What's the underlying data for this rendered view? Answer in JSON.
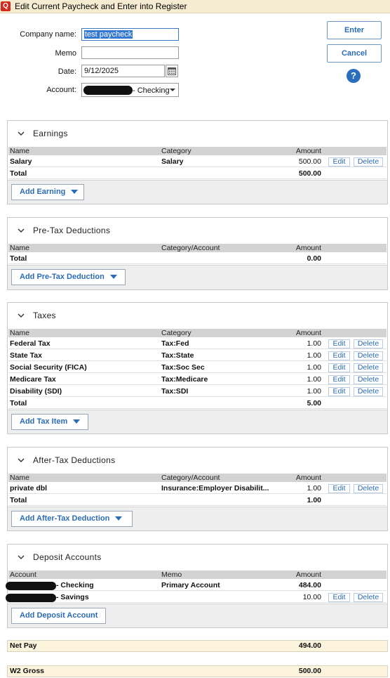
{
  "window": {
    "app_icon": "quicken-icon",
    "title": "Edit Current Paycheck and Enter into Register"
  },
  "header": {
    "company_label": "Company name:",
    "company_value": "test paycheck",
    "memo_label": "Memo",
    "memo_value": "",
    "date_label": "Date:",
    "date_value": "9/12/2025",
    "account_label": "Account:",
    "account_value": "- Checking"
  },
  "actions": {
    "enter": "Enter",
    "cancel": "Cancel",
    "help": "?"
  },
  "earnings": {
    "title": "Earnings",
    "col_name": "Name",
    "col_category": "Category",
    "col_amount": "Amount",
    "rows": [
      {
        "name": "Salary",
        "category": "Salary",
        "amount": "500.00",
        "edit": "Edit",
        "delete": "Delete"
      }
    ],
    "total_label": "Total",
    "total": "500.00",
    "add_label": "Add Earning"
  },
  "pretax": {
    "title": "Pre-Tax Deductions",
    "col_name": "Name",
    "col_category": "Category/Account",
    "col_amount": "Amount",
    "total_label": "Total",
    "total": "0.00",
    "add_label": "Add Pre-Tax Deduction"
  },
  "taxes": {
    "title": "Taxes",
    "col_name": "Name",
    "col_category": "Category",
    "col_amount": "Amount",
    "rows": [
      {
        "name": "Federal Tax",
        "category": "Tax:Fed",
        "amount": "1.00",
        "edit": "Edit",
        "delete": "Delete"
      },
      {
        "name": "State Tax",
        "category": "Tax:State",
        "amount": "1.00",
        "edit": "Edit",
        "delete": "Delete"
      },
      {
        "name": "Social Security (FICA)",
        "category": "Tax:Soc Sec",
        "amount": "1.00",
        "edit": "Edit",
        "delete": "Delete"
      },
      {
        "name": "Medicare Tax",
        "category": "Tax:Medicare",
        "amount": "1.00",
        "edit": "Edit",
        "delete": "Delete"
      },
      {
        "name": "Disability (SDI)",
        "category": "Tax:SDI",
        "amount": "1.00",
        "edit": "Edit",
        "delete": "Delete"
      }
    ],
    "total_label": "Total",
    "total": "5.00",
    "add_label": "Add Tax Item"
  },
  "aftertax": {
    "title": "After-Tax Deductions",
    "col_name": "Name",
    "col_category": "Category/Account",
    "col_amount": "Amount",
    "rows": [
      {
        "name": "private dbl",
        "category": "Insurance:Employer Disabilit...",
        "amount": "1.00",
        "edit": "Edit",
        "delete": "Delete"
      }
    ],
    "total_label": "Total",
    "total": "1.00",
    "add_label": "Add After-Tax Deduction"
  },
  "deposits": {
    "title": "Deposit Accounts",
    "col_account": "Account",
    "col_memo": "Memo",
    "col_amount": "Amount",
    "rows": [
      {
        "account": "- Checking",
        "memo": "Primary Account",
        "amount": "484.00"
      },
      {
        "account": "- Savings",
        "memo": "",
        "amount": "10.00",
        "edit": "Edit",
        "delete": "Delete"
      }
    ],
    "add_label": "Add Deposit Account"
  },
  "summary": {
    "net_pay_label": "Net Pay",
    "net_pay": "494.00",
    "w2_label": "W2 Gross",
    "w2": "500.00"
  }
}
